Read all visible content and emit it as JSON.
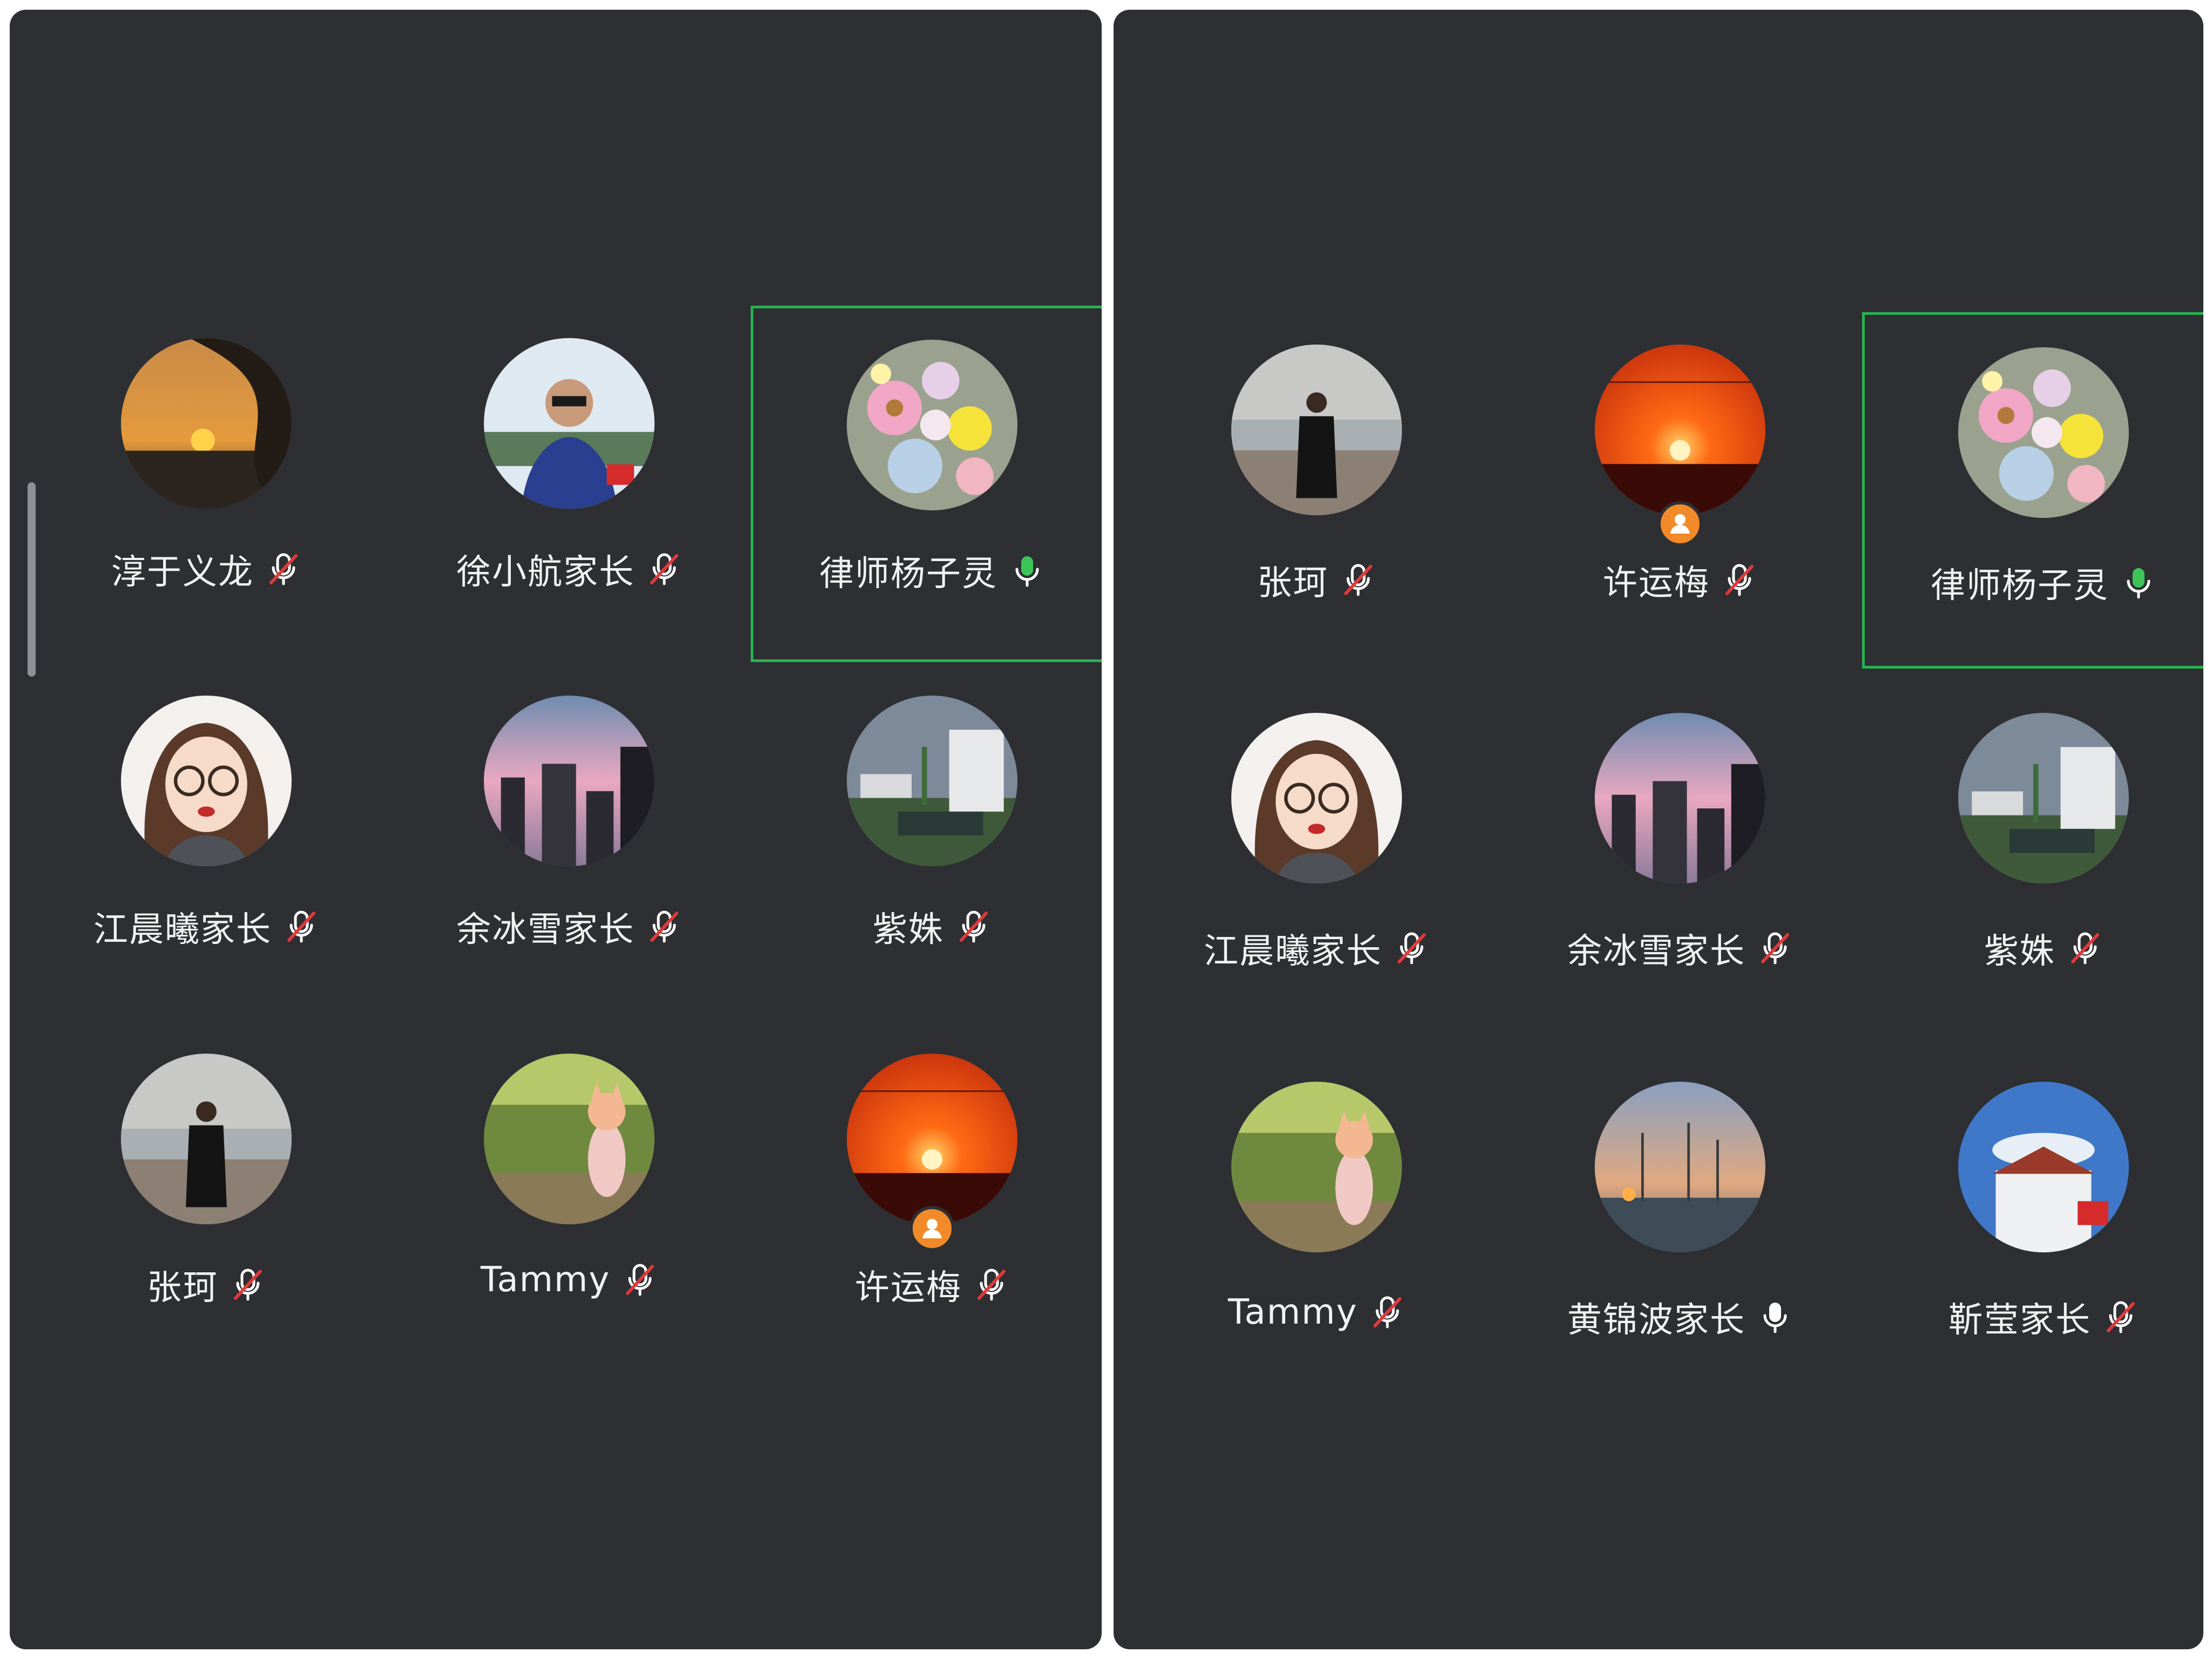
{
  "colors": {
    "panel_bg": "#2d2f33",
    "active_border": "#28b151",
    "host_badge": "#f28a2a",
    "muted_slash": "#e03a3a",
    "speaking_mic": "#3ec55a"
  },
  "left_panel": {
    "participants": [
      {
        "name": "淳于义龙",
        "mic": "muted-mic-icon",
        "host": false,
        "active": false,
        "avatar": "sunset-silhouette-avatar"
      },
      {
        "name": "徐小航家长",
        "mic": "muted-mic-icon",
        "host": false,
        "active": false,
        "avatar": "man-sunglasses-avatar"
      },
      {
        "name": "律师杨子灵",
        "mic": "speaking-mic-icon",
        "host": false,
        "active": true,
        "avatar": "flower-bouquet-avatar"
      },
      {
        "name": "江晨曦家长",
        "mic": "muted-mic-icon",
        "host": false,
        "active": false,
        "avatar": "illustrated-girl-avatar"
      },
      {
        "name": "余冰雪家长",
        "mic": "muted-mic-icon",
        "host": false,
        "active": false,
        "avatar": "pink-sky-buildings-avatar"
      },
      {
        "name": "紫姝",
        "mic": "muted-mic-icon",
        "host": false,
        "active": false,
        "avatar": "villa-garden-avatar"
      },
      {
        "name": "张珂",
        "mic": "muted-mic-icon",
        "host": false,
        "active": false,
        "avatar": "woman-lakeside-avatar"
      },
      {
        "name": "Tammy",
        "mic": "muted-mic-icon",
        "host": false,
        "active": false,
        "avatar": "plush-fox-garden-avatar"
      },
      {
        "name": "许运梅",
        "mic": "muted-mic-icon",
        "host": true,
        "active": false,
        "avatar": "red-sunset-avatar"
      }
    ]
  },
  "right_panel": {
    "participants": [
      {
        "name": "张珂",
        "mic": "muted-mic-icon",
        "host": false,
        "active": false,
        "avatar": "woman-lakeside-avatar"
      },
      {
        "name": "许运梅",
        "mic": "muted-mic-icon",
        "host": true,
        "active": false,
        "avatar": "red-sunset-avatar"
      },
      {
        "name": "律师杨子灵",
        "mic": "speaking-mic-icon",
        "host": false,
        "active": true,
        "avatar": "flower-bouquet-avatar"
      },
      {
        "name": "江晨曦家长",
        "mic": "muted-mic-icon",
        "host": false,
        "active": false,
        "avatar": "illustrated-girl-avatar"
      },
      {
        "name": "余冰雪家长",
        "mic": "muted-mic-icon",
        "host": false,
        "active": false,
        "avatar": "pink-sky-buildings-avatar"
      },
      {
        "name": "紫姝",
        "mic": "muted-mic-icon",
        "host": false,
        "active": false,
        "avatar": "villa-garden-avatar"
      },
      {
        "name": "Tammy",
        "mic": "muted-mic-icon",
        "host": false,
        "active": false,
        "avatar": "plush-fox-garden-avatar"
      },
      {
        "name": "黄锦波家长",
        "mic": "open-mic-icon",
        "host": false,
        "active": false,
        "avatar": "sunset-reflection-avatar"
      },
      {
        "name": "靳莹家长",
        "mic": "muted-mic-icon",
        "host": false,
        "active": false,
        "avatar": "blue-sky-house-avatar"
      }
    ]
  }
}
